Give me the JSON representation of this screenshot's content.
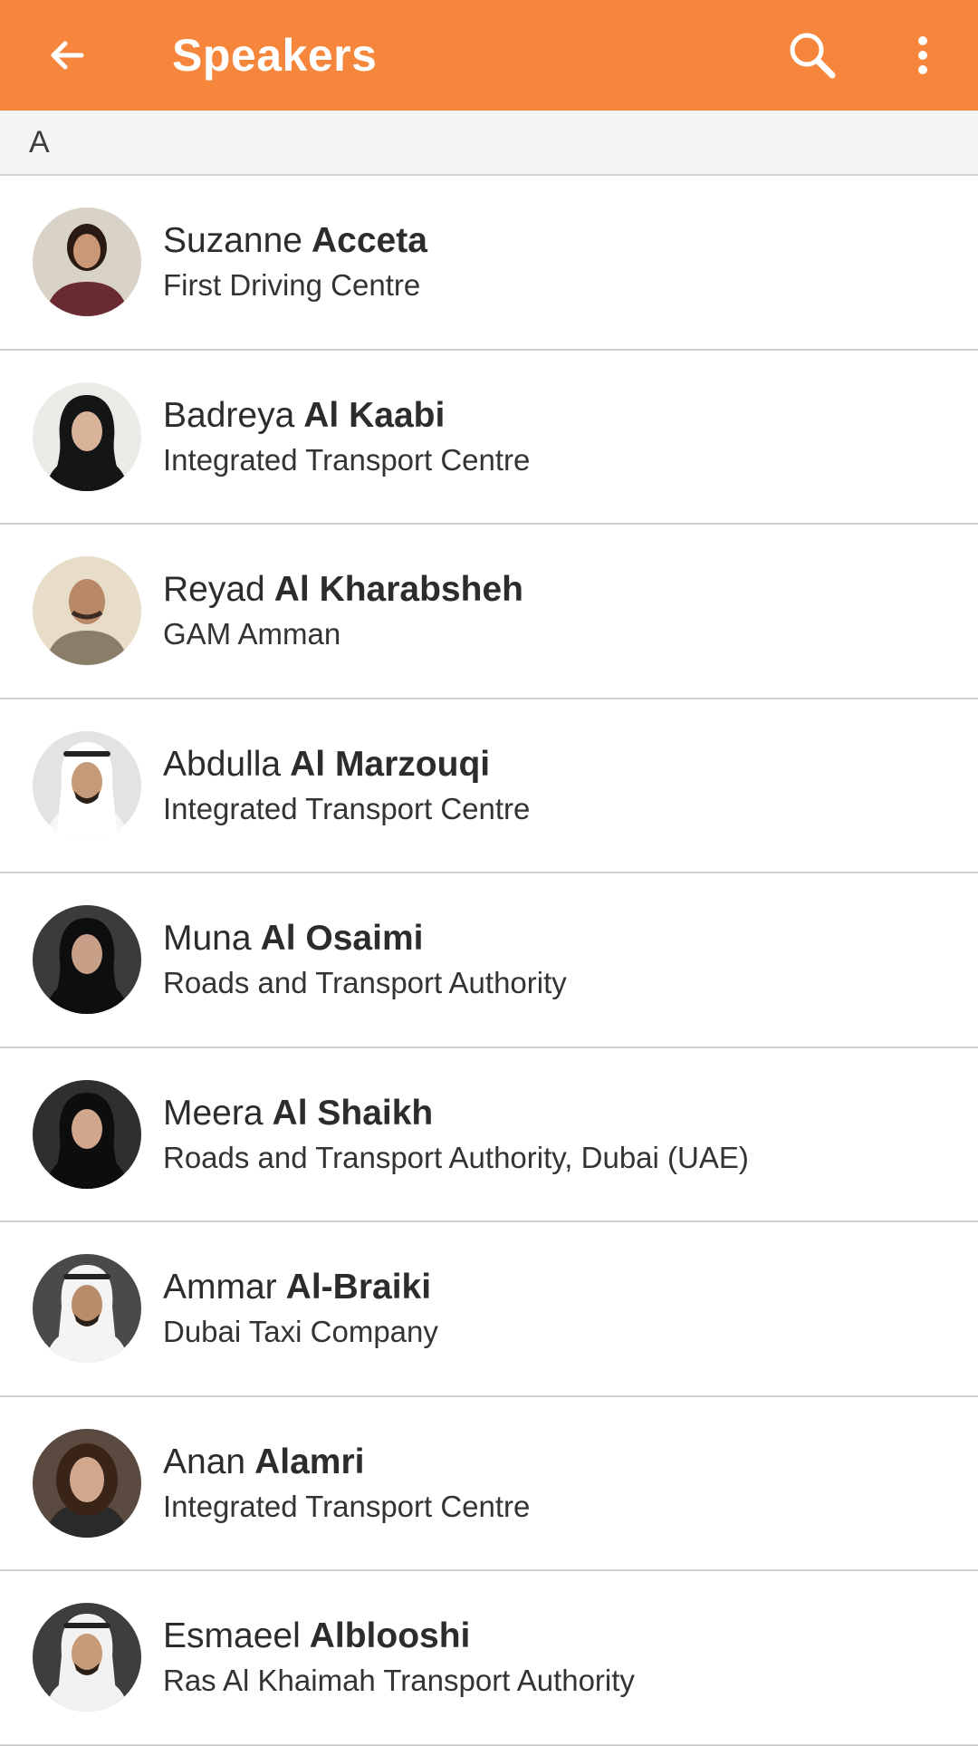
{
  "appbar": {
    "title": "Speakers",
    "back_icon": "arrow-left-icon",
    "search_icon": "search-icon",
    "menu_icon": "more-vert-icon",
    "color": "#f5863c"
  },
  "section": {
    "letter": "A"
  },
  "speakers": [
    {
      "first": "Suzanne",
      "last": "Acceta",
      "org": "First Driving Centre"
    },
    {
      "first": "Badreya",
      "last": "Al Kaabi",
      "org": "Integrated Transport Centre"
    },
    {
      "first": "Reyad",
      "last": "Al Kharabsheh",
      "org": "GAM Amman"
    },
    {
      "first": "Abdulla",
      "last": "Al Marzouqi",
      "org": "Integrated Transport Centre"
    },
    {
      "first": "Muna",
      "last": "Al Osaimi",
      "org": "Roads and Transport Authority"
    },
    {
      "first": "Meera",
      "last": "Al Shaikh",
      "org": "Roads and Transport Authority, Dubai (UAE)"
    },
    {
      "first": "Ammar",
      "last": "Al-Braiki",
      "org": "Dubai Taxi Company"
    },
    {
      "first": "Anan",
      "last": "Alamri",
      "org": "Integrated Transport Centre"
    },
    {
      "first": "Esmaeel",
      "last": "Alblooshi",
      "org": "Ras Al Khaimah Transport Authority"
    }
  ]
}
